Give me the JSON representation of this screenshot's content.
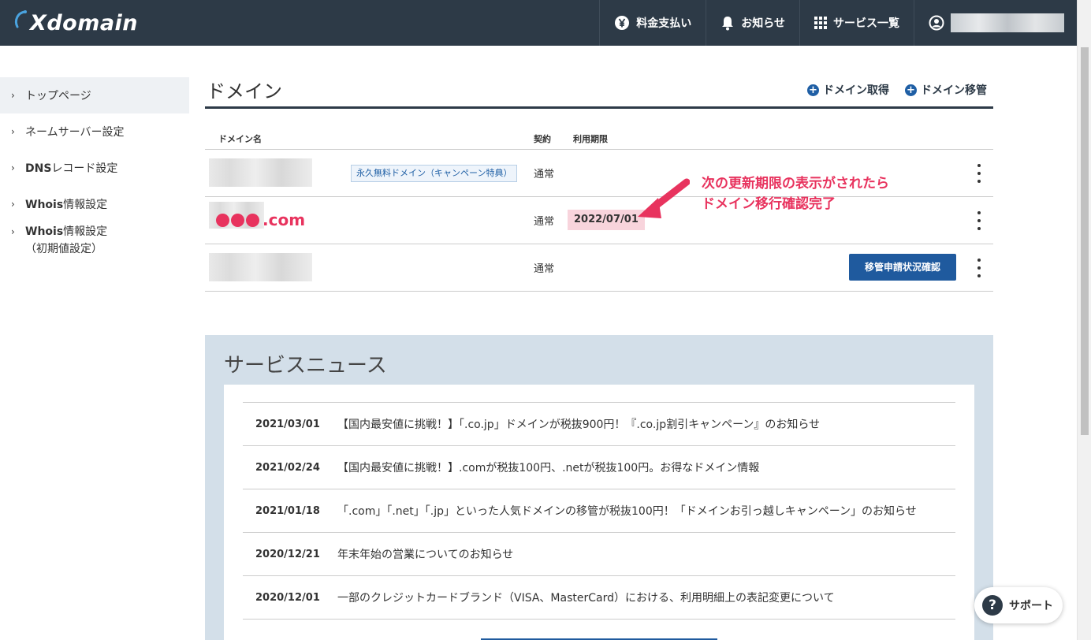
{
  "brand": {
    "logo_text": "Xdomain"
  },
  "topnav": {
    "payment": "料金支払い",
    "notice": "お知らせ",
    "services": "サービス一覧"
  },
  "sidebar": {
    "items": [
      {
        "label": "トップページ"
      },
      {
        "label": "ネームサーバー設定"
      },
      {
        "prefix": "DNS",
        "label": "レコード設定"
      },
      {
        "prefix": "Whois",
        "label": "情報設定"
      },
      {
        "prefix": "Whois",
        "label": "情報設定",
        "sub": "（初期値設定）"
      }
    ]
  },
  "domain": {
    "title": "ドメイン",
    "acquire_label": "ドメイン取得",
    "transfer_label": "ドメイン移管",
    "columns": {
      "name": "ドメイン名",
      "contract": "契約",
      "expiry": "利用期限"
    },
    "rows": [
      {
        "tag": "永久無料ドメイン（キャンペーン特典）",
        "contract": "通常",
        "expiry": ""
      },
      {
        "name_com": ".com",
        "contract": "通常",
        "expiry": "2022/07/01"
      },
      {
        "contract": "通常",
        "button": "移管申請状況確認"
      }
    ]
  },
  "annotation": {
    "line1": "次の更新期限の表示がされたら",
    "line2": "ドメイン移行確認完了"
  },
  "news": {
    "title": "サービスニュース",
    "items": [
      {
        "date": "2021/03/01",
        "text": "【国内最安値に挑戦！】「.co.jp」ドメインが税抜900円！『.co.jp割引キャンペーン』のお知らせ"
      },
      {
        "date": "2021/02/24",
        "text": "【国内最安値に挑戦！】.comが税抜100円、.netが税抜100円。お得なドメイン情報"
      },
      {
        "date": "2021/01/18",
        "text": "「.com」「.net」「.jp」といった人気ドメインの移管が税抜100円！「ドメインお引っ越しキャンペーン」のお知らせ"
      },
      {
        "date": "2020/12/21",
        "text": "年末年始の営業についてのお知らせ"
      },
      {
        "date": "2020/12/01",
        "text": "一部のクレジットカードブランド（VISA、MasterCard）における、利用明細上の表記変更について"
      }
    ]
  },
  "support": {
    "label": "サポート"
  },
  "colors": {
    "header": "#2d3a47",
    "accent": "#1f5a9e",
    "highlight": "#e8335e",
    "expiry_bg": "#f8d4dc",
    "news_bg": "#d3dfe9"
  }
}
